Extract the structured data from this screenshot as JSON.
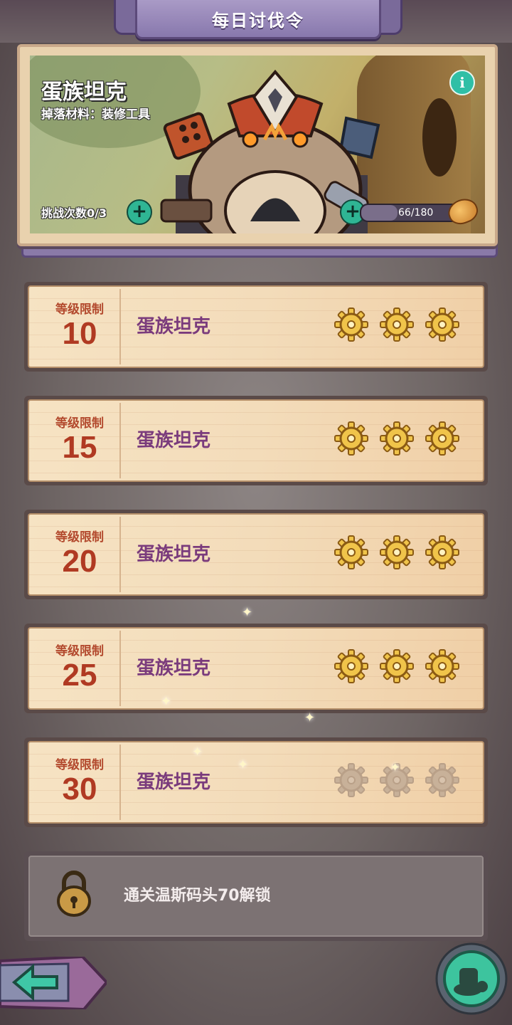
{
  "header": {
    "title": "每日讨伐令"
  },
  "boss": {
    "name": "蛋族坦克",
    "drop": "掉落材料：装修工具",
    "challenge": "挑战次数0/3",
    "stamina": "66/180",
    "stamina_ratio": 0.367,
    "info_icon": "i"
  },
  "levels": [
    {
      "tag": "等级限制",
      "level": "10",
      "name": "蛋族坦克",
      "stars": 3,
      "unlocked": true
    },
    {
      "tag": "等级限制",
      "level": "15",
      "name": "蛋族坦克",
      "stars": 3,
      "unlocked": true
    },
    {
      "tag": "等级限制",
      "level": "20",
      "name": "蛋族坦克",
      "stars": 3,
      "unlocked": true
    },
    {
      "tag": "等级限制",
      "level": "25",
      "name": "蛋族坦克",
      "stars": 3,
      "unlocked": true
    },
    {
      "tag": "等级限制",
      "level": "30",
      "name": "蛋族坦克",
      "stars": 0,
      "unlocked": true
    }
  ],
  "locked": {
    "text": "通关温斯码头70解锁"
  },
  "icons": {
    "back": "arrow-left-icon",
    "home": "home-icon",
    "lock": "padlock-icon",
    "gear": "gear-star-icon"
  },
  "colors": {
    "accent": "#2fb594",
    "level_text": "#b03a22",
    "boss_text": "#7a3b7c"
  }
}
